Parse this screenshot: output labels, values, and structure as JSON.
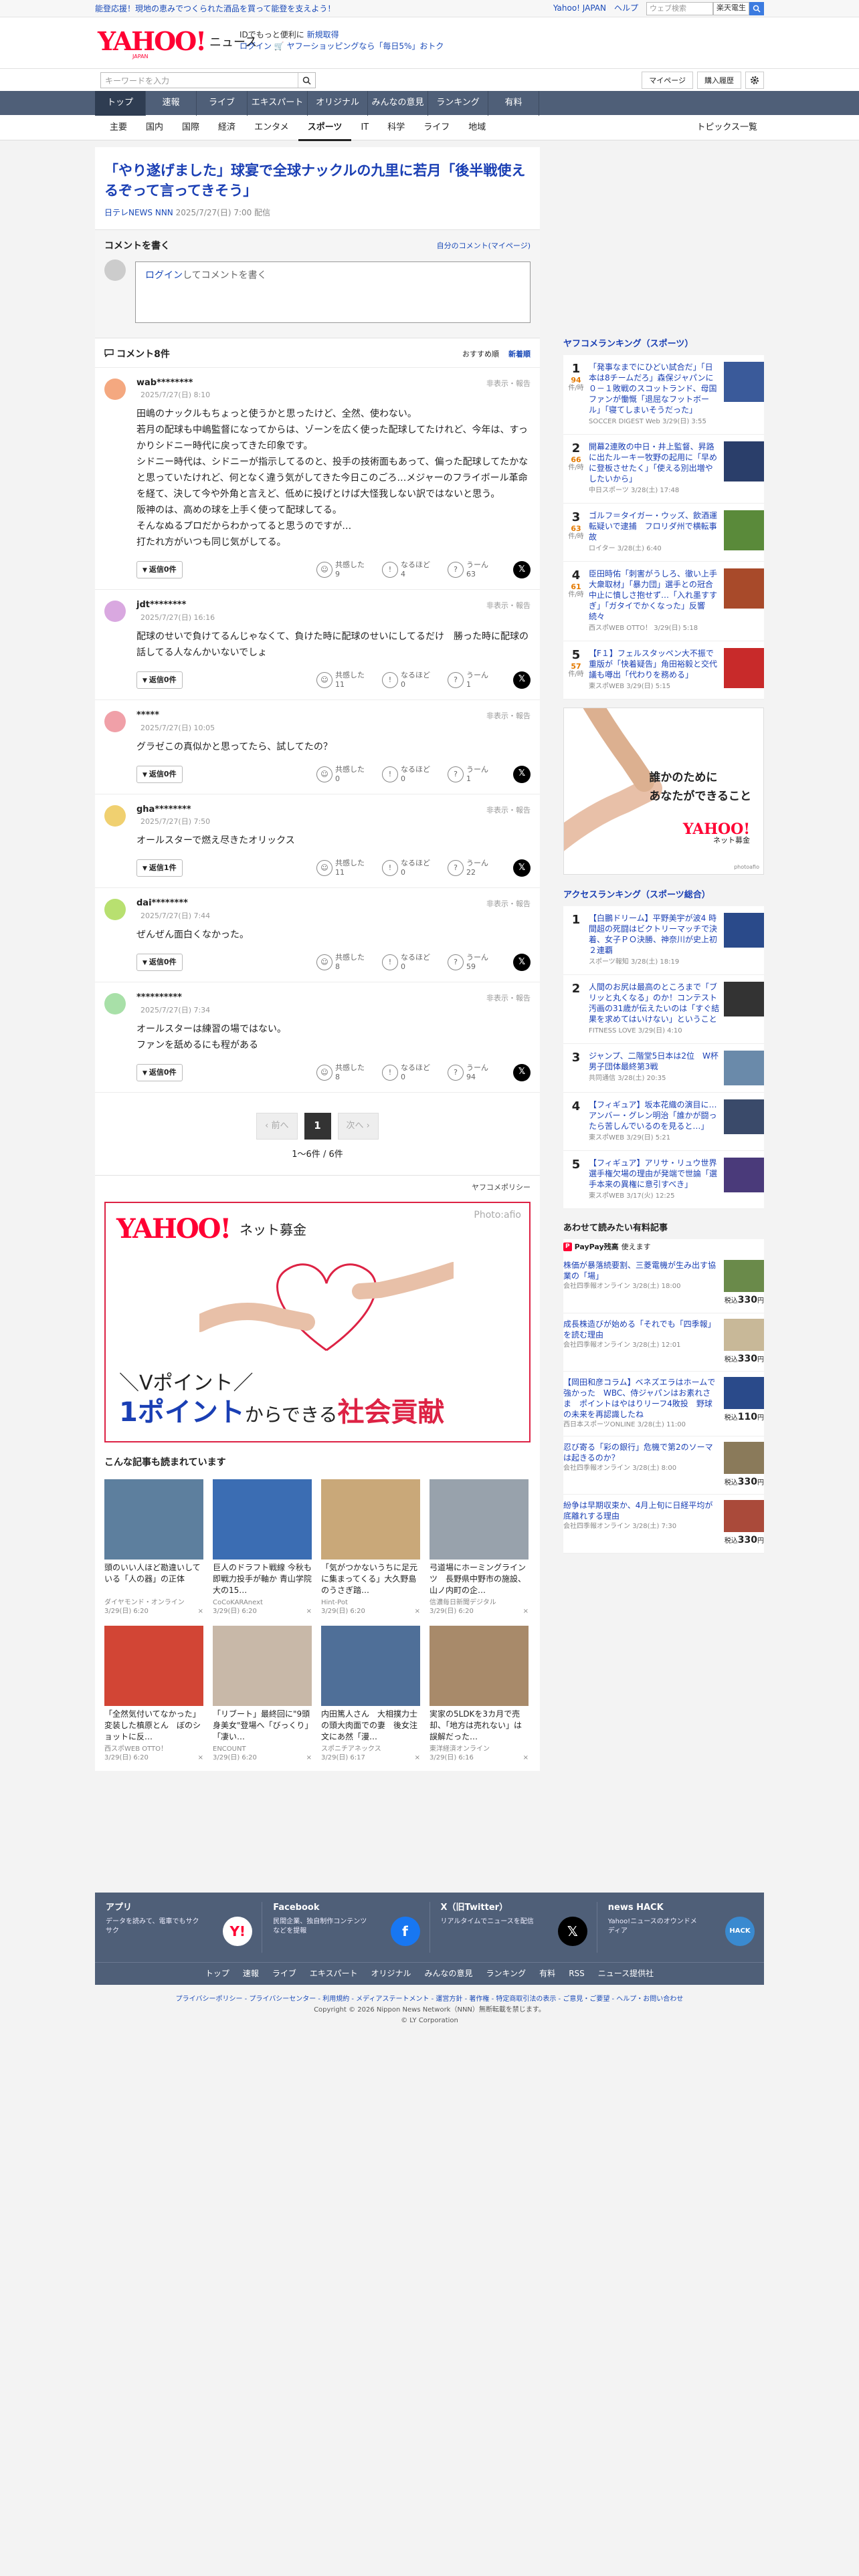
{
  "topbar": {
    "promo": "能登応援！現地の恵みでつくられた酒品を買って能登を支えよう！",
    "links": [
      "Yahoo! JAPAN",
      "ヘルプ"
    ],
    "search_placeholder": "ウェブ検索",
    "search_button": "楽天電生",
    "search_icon": "search-icon"
  },
  "header": {
    "logo_text": "YAHOO!",
    "logo_sub": "JAPAN",
    "site_name": "ニュース",
    "info_line1_a": "IDでもっと便利に",
    "info_line1_b": "新規取得",
    "info_line2_login": "ログイン",
    "info_line2_text": "ヤフーショッピングなら「毎日5%」おトク"
  },
  "search": {
    "placeholder": "キーワードを入力",
    "mypage": "マイページ",
    "history": "購入履歴"
  },
  "global_nav": [
    "トップ",
    "速報",
    "ライブ",
    "エキスパート",
    "オリジナル",
    "みんなの意見",
    "ランキング",
    "有料"
  ],
  "sub_nav": [
    "主要",
    "国内",
    "国際",
    "経済",
    "エンタメ",
    "スポーツ",
    "IT",
    "科学",
    "ライフ",
    "地域"
  ],
  "sub_nav_active": "スポーツ",
  "topics_list": "トピックス一覧",
  "article": {
    "title": "「やり遂げました」球宴で全球ナックルの九里に若月「後半戦使えるぞって言ってきそう」",
    "source": "日テレNEWS NNN",
    "date": "2025/7/27(日) 7:00 配信"
  },
  "comment_write": {
    "heading": "コメントを書く",
    "my_comments": "自分のコメント(マイページ)",
    "login": "ログイン",
    "placeholder_rest": "してコメントを書く"
  },
  "comments_header": {
    "title": "コメント8件",
    "sort_recommended": "おすすめ順",
    "sort_new": "新着順"
  },
  "reaction_labels": {
    "empathy": "共感した",
    "naruhodo": "なるほど",
    "hmm": "うーん",
    "report": "非表示・報告"
  },
  "comments": [
    {
      "user": "wab********",
      "date": "2025/7/27(日) 8:10",
      "avatar_color": "#f4a880",
      "body": "田嶋のナックルもちょっと使うかと思ったけど、全然、使わない。\n若月の配球も中嶋監督になってからは、ゾーンを広く使った配球してたけれど、今年は、すっかりシドニー時代に戻ってきた印象です。\nシドニー時代は、シドニーが指示してるのと、投手の技術面もあって、偏った配球してたかなと思っていたけれど、何となく違う気がしてきた今日このごろ…メジャーのフライボール革命を経て、決して今や外角と言えど、低めに投げとけば大怪我しない訳ではないと思う。\n阪神のは、高めの球を上手く使って配球してる。\nそんなぬるプロだからわかってると思うのですが…\n打たれ方がいつも同じ気がしてる。",
      "reply": "返信0件",
      "e": "9",
      "n": "4",
      "h": "63"
    },
    {
      "user": "jdt********",
      "date": "2025/7/27(日) 16:16",
      "avatar_color": "#d9a8e0",
      "body": "配球のせいで負けてるんじゃなくて、負けた時に配球のせいにしてるだけ　勝った時に配球の話してる人なんかいないでしょ",
      "reply": "返信0件",
      "e": "11",
      "n": "0",
      "h": "1"
    },
    {
      "user": "*****",
      "date": "2025/7/27(日) 10:05",
      "avatar_color": "#f0a0a8",
      "body": "グラゼこの真似かと思ってたら、試してたの？",
      "reply": "返信0件",
      "e": "0",
      "n": "0",
      "h": "1"
    },
    {
      "user": "gha********",
      "date": "2025/7/27(日) 7:50",
      "avatar_color": "#f0d070",
      "body": "オールスターで燃え尽きたオリックス",
      "reply": "返信1件",
      "e": "11",
      "n": "0",
      "h": "22"
    },
    {
      "user": "dai********",
      "date": "2025/7/27(日) 7:44",
      "avatar_color": "#b8e070",
      "body": "ぜんぜん面白くなかった。",
      "reply": "返信0件",
      "e": "8",
      "n": "0",
      "h": "59"
    },
    {
      "user": "**********",
      "date": "2025/7/27(日) 7:34",
      "avatar_color": "#a8e0a8",
      "body": "オールスターは練習の場ではない。\nファンを舐めるにも程がある",
      "reply": "返信0件",
      "e": "8",
      "n": "0",
      "h": "94"
    }
  ],
  "pager": {
    "prev": "前へ",
    "page": "1",
    "next": "次へ",
    "count": "1〜6件 / 6件"
  },
  "policy": "ヤフコメポリシー",
  "big_ad": {
    "logo": "YAHOO!",
    "logo_sub": "ネット募金",
    "photo": "Photo:afio",
    "line1": "＼Vポイント／",
    "line2a": "1ポイント",
    "line2b": "からできる",
    "line2c": "社会貢献"
  },
  "related": {
    "heading": "こんな記事も読まれています",
    "items": [
      {
        "title": "頭のいい人ほど勘違いしている「人の器」の正体",
        "source": "ダイヤモンド・オンライン",
        "date": "3/29(日) 6:20",
        "color": "#5d7f9e"
      },
      {
        "title": "巨人のドラフト戦線 今秋も即戦力投手が軸か 青山学院大の15…",
        "source": "CoCoKARAnext",
        "date": "3/29(日) 6:20",
        "color": "#3b6db3"
      },
      {
        "title": "「気がつかないうちに足元に集まってくる」大久野島のうさぎ踏…",
        "source": "Hint-Pot",
        "date": "3/29(日) 6:20",
        "color": "#c9a879"
      },
      {
        "title": "弓道場にホーミングラインツ　長野県中野市の施設、山ノ内町の企…",
        "source": "信濃毎日新聞デジタル",
        "date": "3/29(日) 6:20",
        "color": "#98a2ac"
      },
      {
        "title": "「全然気付いてなかった」変装した槙原とん　ぼのショットに反…",
        "source": "西スポWEB OTTO！",
        "date": "3/29(日) 6:20",
        "color": "#d24535"
      },
      {
        "title": "「リブート」最終回に\"9頭身美女\"登場へ「びっくり」「凄い…",
        "source": "ENCOUNT",
        "date": "3/29(日) 6:20",
        "color": "#c8b8a8"
      },
      {
        "title": "内田篤人さん　大相撲力士の頭大肉面での妻　後女注文にあ然「漫…",
        "source": "スポニチアネックス",
        "date": "3/29(日) 6:17",
        "color": "#4f6f98"
      },
      {
        "title": "実家の5LDKを3カ月で売却、「地方は売れない」は誤解だった…",
        "source": "東洋経済オンライン",
        "date": "3/29(日) 6:16",
        "color": "#a88a6a"
      }
    ]
  },
  "sports_ranking": {
    "heading": "ヤフコメランキング（スポーツ）",
    "items": [
      {
        "rank": "1",
        "count": "94",
        "unit": "件/時",
        "title": "「発事なまでにひどい試合だ」「日本は8チームだろ」森保ジャパンに０－１敗戦のスコットランド、母国ファンが慟慨「退屈なフットボール」「寝てしまいそうだった」",
        "source": "SOCCER DIGEST Web",
        "date": "3/29(日) 3:55",
        "color": "#3a5a9a"
      },
      {
        "rank": "2",
        "count": "66",
        "unit": "件/時",
        "title": "開幕2連敗の中日・井上監督、昇路に出たルーキー牧野の起用に「早めに登板させたく」「使える別出増やしたいから」",
        "source": "中日スポーツ",
        "date": "3/28(土) 17:48",
        "color": "#2a3e6a"
      },
      {
        "rank": "3",
        "count": "63",
        "unit": "件/時",
        "title": "ゴルフ＝タイガー・ウッズ、飲酒運転疑いで逮捕　フロリダ州で横転事故",
        "source": "ロイター",
        "date": "3/28(土) 6:40",
        "color": "#5a8a3a"
      },
      {
        "rank": "4",
        "count": "61",
        "unit": "件/時",
        "title": "臣田時佑「刺害がうしろ、徹い上手大衆取材」「暴力団」選手との冠合中止に憤しさ抱せず…「入れ墨すすぎ」「ガタイでかくなった」反響続々",
        "source": "西スポWEB OTTO！",
        "date": "3/29(日) 5:18",
        "color": "#a84a2a"
      },
      {
        "rank": "5",
        "count": "57",
        "unit": "件/時",
        "title": "【F１】フェルスタッペン大不振で重版が「快着疑告」角田裕毅と交代議も噂出「代わりを務める」",
        "source": "東スポWEB",
        "date": "3/29(日) 5:15",
        "color": "#c82a2a"
      }
    ]
  },
  "side_ad": {
    "line1": "誰かのために",
    "line2": "あなたができること",
    "logo": "YAHOO!",
    "logo_sub": "ネット募金",
    "photo": "photoafio"
  },
  "access_ranking": {
    "heading": "アクセスランキング（スポーツ総合）",
    "items": [
      {
        "rank": "1",
        "title": "【白鵬ドリーム】平野美宇が波4 時間超の死闘はビクトリーマッチで決着、女子ＰＯ決勝、神奈川が史上初２連覇",
        "source": "スポーツ報知",
        "date": "3/28(土) 18:19",
        "color": "#2a4a8a"
      },
      {
        "rank": "2",
        "title": "人間のお尻は最高のところまで「ブリッと丸くなる」のか！コンテスト汚画の31歳が伝えたいのは「すぐ結果を求めてはいけない」ということ",
        "source": "FITNESS LOVE",
        "date": "3/29(日) 4:10",
        "color": "#333333"
      },
      {
        "rank": "3",
        "title": "ジャンプ、二階堂5日本は2位　W杯男子団体最終第3戦",
        "source": "共同通信",
        "date": "3/28(土) 20:35",
        "color": "#6a8aaa"
      },
      {
        "rank": "4",
        "title": "【フィギュア】坂本花織の演目に…アンバー・グレン明治「誰かが闘ったら苦しんでいるのを見ると…」",
        "source": "東スポWEB",
        "date": "3/29(日) 5:21",
        "color": "#3a4a6a"
      },
      {
        "rank": "5",
        "title": "【フィギュア】アリサ・リュウ世界選手権欠場の理由が発端で世論「選手本来の異権に意引すべき」",
        "source": "東スポWEB",
        "date": "3/17(火) 12:25",
        "color": "#4a3a7a"
      }
    ]
  },
  "paid": {
    "heading": "あわせて読みたい有料記事",
    "paypay_label": "PayPay残高",
    "paypay_text": "使えます",
    "items": [
      {
        "title": "株価が暴落続要割、三菱電機が生み出す協業の「場」",
        "source": "会社四季報オンライン",
        "date": "3/28(土) 18:00",
        "price": "330",
        "color": "#6a8a4a"
      },
      {
        "title": "成長株造びが始める「それでも「四季報」を読む理由",
        "source": "会社四季報オンライン",
        "date": "3/28(土) 12:01",
        "price": "330",
        "color": "#c8b898"
      },
      {
        "title": "【岡田和彦コラム】ベネズエラはホームで強かった　WBC、侍ジャパンはお素れさま　ポイントはやはりリーフ4敗投　野球の未来を再認識したね",
        "source": "西日本スポーツONLINE",
        "date": "3/28(土) 11:00",
        "price": "110",
        "color": "#2a4a8a"
      },
      {
        "title": "忍び寄る「彩の銀行」危機で第2のソーマは起きるのか？",
        "source": "会社四季報オンライン",
        "date": "3/28(土) 8:00",
        "price": "330",
        "color": "#8a7a5a"
      },
      {
        "title": "紛争は早期収束か、4月上旬に日経平均が底離れする理由",
        "source": "会社四季報オンライン",
        "date": "3/28(土) 7:30",
        "price": "330",
        "color": "#aa4a3a"
      }
    ]
  },
  "price_prefix": "税込",
  "price_suffix": "円",
  "footer": {
    "cols": [
      {
        "name": "アプリ",
        "desc": "データを読みて、電車でもサクサク",
        "icon": "Y!",
        "bg": "#ffffff",
        "fg": "#ff0033"
      },
      {
        "name": "Facebook",
        "desc": "民間企業、独自制作コンテンツなどを提報",
        "icon": "f",
        "bg": "#1877f2",
        "fg": "#ffffff"
      },
      {
        "name": "X（旧Twitter）",
        "desc": "リアルタイムでニュースを配信",
        "icon": "𝕏",
        "bg": "#000000",
        "fg": "#ffffff"
      },
      {
        "name": "news HACK",
        "desc": "Yahoo!ニュースのオウンドメディア",
        "icon": "HACK",
        "bg": "#3a8ad0",
        "fg": "#ffffff"
      }
    ],
    "links": [
      "トップ",
      "速報",
      "ライブ",
      "エキスパート",
      "オリジナル",
      "みんなの意見",
      "ランキング",
      "有料",
      "RSS",
      "ニュース提供社"
    ],
    "bottom_links": "プライバシーポリシー - プライバシーセンター - 利用規約 - メディアステートメント - 運営方針 - 著作権 - 特定商取引法の表示 - ご意見・ご要望 - ヘルプ・お問い合わせ",
    "copyright": "Copyright © 2026 Nippon News Network（NNN）無断転載を禁じます。",
    "corp": "© LY Corporation"
  }
}
